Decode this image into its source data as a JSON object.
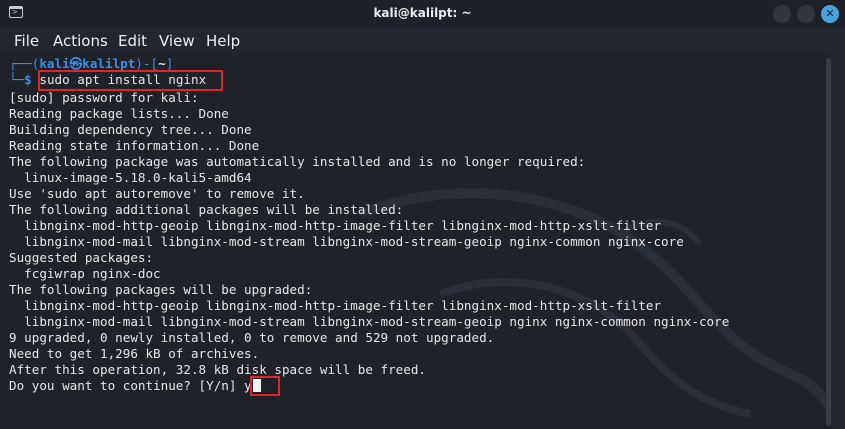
{
  "window": {
    "title": "kali@kalilpt: ~",
    "close_glyph": "✕"
  },
  "menu": [
    "File",
    "Actions",
    "Edit",
    "View",
    "Help"
  ],
  "prompt": {
    "top_left": "┌──(",
    "user_host": "kali㉿kalilpt",
    "top_mid": ")-[",
    "dir": "~",
    "top_right": "]",
    "bottom": "└─",
    "dollar": "$",
    "command": "sudo apt install nginx"
  },
  "output": [
    "[sudo] password for kali:",
    "Reading package lists... Done",
    "Building dependency tree... Done",
    "Reading state information... Done",
    "The following package was automatically installed and is no longer required:",
    "  linux-image-5.18.0-kali5-amd64",
    "Use 'sudo apt autoremove' to remove it.",
    "The following additional packages will be installed:",
    "  libnginx-mod-http-geoip libnginx-mod-http-image-filter libnginx-mod-http-xslt-filter",
    "  libnginx-mod-mail libnginx-mod-stream libnginx-mod-stream-geoip nginx-common nginx-core",
    "Suggested packages:",
    "  fcgiwrap nginx-doc",
    "The following packages will be upgraded:",
    "  libnginx-mod-http-geoip libnginx-mod-http-image-filter libnginx-mod-http-xslt-filter",
    "  libnginx-mod-mail libnginx-mod-stream libnginx-mod-stream-geoip nginx nginx-common nginx-core",
    "9 upgraded, 0 newly installed, 0 to remove and 529 not upgraded.",
    "Need to get 1,296 kB of archives.",
    "After this operation, 32.8 kB disk space will be freed."
  ],
  "confirm": {
    "question": "Do you want to continue? [Y/n] ",
    "answer": "y"
  },
  "colors": {
    "prompt_blue": "#3b8eea",
    "highlight_red": "#e0242a",
    "terminal_bg": "#1f2229"
  },
  "icons": {
    "app": "terminal-icon",
    "minimize": "minimize-icon",
    "maximize": "maximize-icon",
    "close": "close-icon"
  }
}
